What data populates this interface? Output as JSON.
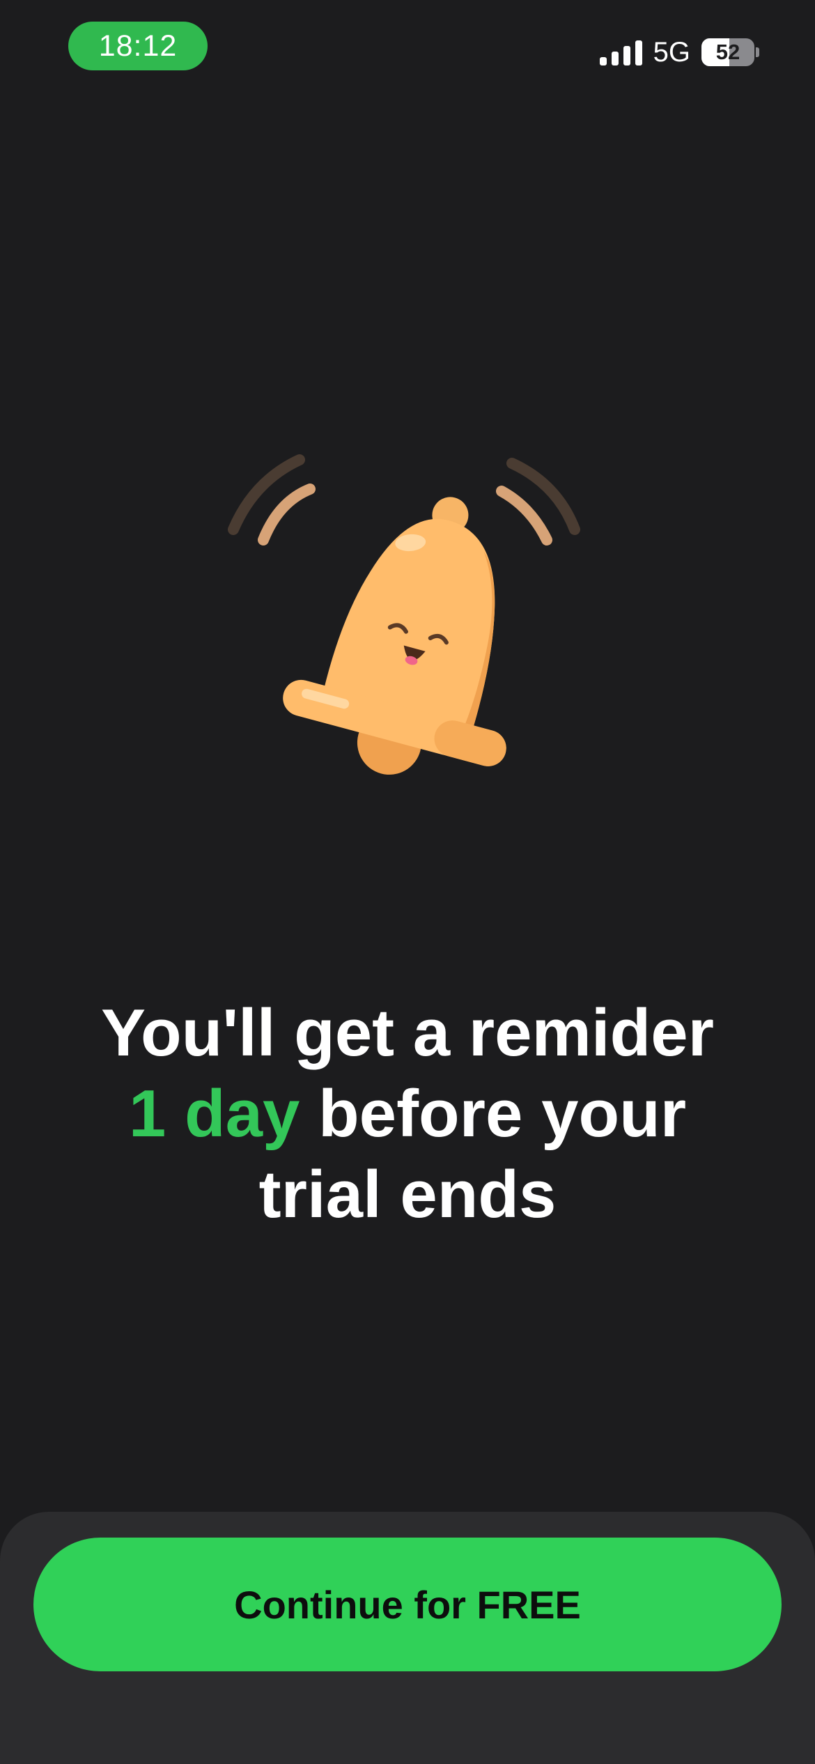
{
  "status_bar": {
    "time": "18:12",
    "network": "5G",
    "battery_level": "52",
    "battery_fraction": 0.52,
    "signal_bars": 4
  },
  "illustration": {
    "icon": "bell-icon",
    "colors": {
      "bell": "#ffb866",
      "bell_shade": "#f0a14f",
      "waves_inner": "#d7a377",
      "waves_outer": "#4a3c32"
    }
  },
  "headline": {
    "line1": "You'll get a remider",
    "accent": "1 day",
    "line2_rest": " before your",
    "line3": "trial ends"
  },
  "cta": {
    "label": "Continue for FREE"
  },
  "colors": {
    "background": "#1c1c1e",
    "accent": "#33c759",
    "button": "#30d158",
    "panel": "#2c2c2e"
  }
}
